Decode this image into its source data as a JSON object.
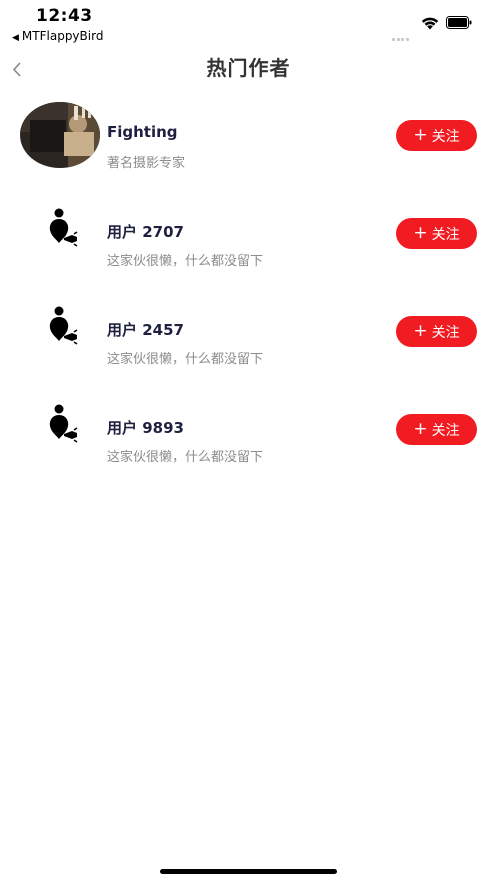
{
  "status_bar": {
    "time": "12:43",
    "back_app": "MTFlappyBird",
    "back_arrow": "◀"
  },
  "nav": {
    "title": "热门作者",
    "back_icon": "chevron-left-icon"
  },
  "authors": [
    {
      "name": "Fighting",
      "desc": "著名摄影专家",
      "avatar": "photo",
      "follow_label": "关注",
      "follow_plus": "+"
    },
    {
      "name": "用户 2707",
      "desc": "这家伙很懒，什么都没留下",
      "avatar": "default-user-icon",
      "follow_label": "关注",
      "follow_plus": "+"
    },
    {
      "name": "用户 2457",
      "desc": "这家伙很懒，什么都没留下",
      "avatar": "default-user-icon",
      "follow_label": "关注",
      "follow_plus": "+"
    },
    {
      "name": "用户 9893",
      "desc": "这家伙很懒，什么都没留下",
      "avatar": "default-user-icon",
      "follow_label": "关注",
      "follow_plus": "+"
    }
  ],
  "colors": {
    "follow_button": "#f11c22",
    "name_text": "#1e2040",
    "desc_text": "#8c8c8c"
  }
}
